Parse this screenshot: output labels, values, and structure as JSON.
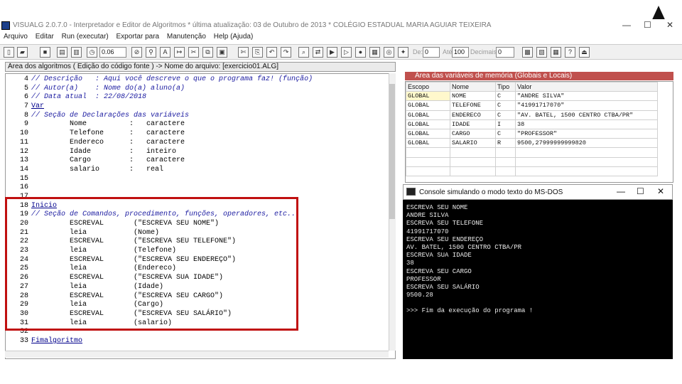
{
  "window": {
    "title": "VISUALG 2.0.7.0 - Interpretador e Editor de Algoritmos * última atualização: 03 de Outubro de 2013 * COLÉGIO ESTADUAL MARIA AGUIAR TEIXEIRA",
    "minimize": "—",
    "maximize": "☐",
    "close": "✕"
  },
  "menu": [
    "Arquivo",
    "Editar",
    "Run (executar)",
    "Exportar para",
    "Manutenção",
    "Help (Ajuda)"
  ],
  "toolbar": {
    "font_size": "0.06",
    "de_label": "De:",
    "de_value": "0",
    "ate_label": "Até:",
    "ate_value": "100",
    "decimais_label": "Decimais:",
    "decimais_value": "0"
  },
  "editor": {
    "header": "Área dos algoritmos ( Edição do código fonte ) -> Nome do arquivo: [exercicio01.ALG]",
    "lines": [
      {
        "n": "4",
        "t": "// Descrição   : Aqui você descreve o que o programa faz! (função)",
        "k": "comment"
      },
      {
        "n": "5",
        "t": "// Autor(a)    : Nome do(a) aluno(a)",
        "k": "comment"
      },
      {
        "n": "6",
        "t": "// Data atual  : 22/08/2018",
        "k": "comment"
      },
      {
        "n": "7",
        "t": "Var",
        "k": "kw"
      },
      {
        "n": "8",
        "t": "// Seção de Declarações das variáveis",
        "k": "comment"
      },
      {
        "n": "9",
        "t": "         Nome          :   caractere",
        "k": "decl"
      },
      {
        "n": "10",
        "t": "         Telefone      :   caractere",
        "k": "decl"
      },
      {
        "n": "11",
        "t": "         Endereco      :   caractere",
        "k": "decl"
      },
      {
        "n": "12",
        "t": "         Idade         :   inteiro",
        "k": "decl"
      },
      {
        "n": "13",
        "t": "         Cargo         :   caractere",
        "k": "decl"
      },
      {
        "n": "14",
        "t": "         salario       :   real",
        "k": "decl"
      },
      {
        "n": "15",
        "t": "",
        "k": "plain"
      },
      {
        "n": "16",
        "t": "",
        "k": "plain"
      },
      {
        "n": "17",
        "t": "",
        "k": "plain"
      },
      {
        "n": "18",
        "t": "Inicio",
        "k": "kw"
      },
      {
        "n": "19",
        "t": "// Seção de Comandos, procedimento, funções, operadores, etc...",
        "k": "comment"
      },
      {
        "n": "20",
        "t": "         ESCREVAL       (\"ESCREVA SEU NOME\")",
        "k": "cmd"
      },
      {
        "n": "21",
        "t": "         leia           (Nome)",
        "k": "plain"
      },
      {
        "n": "22",
        "t": "         ESCREVAL       (\"ESCREVA SEU TELEFONE\")",
        "k": "cmd"
      },
      {
        "n": "23",
        "t": "         leia           (Telefone)",
        "k": "plain"
      },
      {
        "n": "24",
        "t": "         ESCREVAL       (\"ESCREVA SEU ENDEREÇO\")",
        "k": "cmd"
      },
      {
        "n": "25",
        "t": "         leia           (Endereco)",
        "k": "plain"
      },
      {
        "n": "26",
        "t": "         ESCREVAL       (\"ESCREVA SUA IDADE\")",
        "k": "cmd"
      },
      {
        "n": "27",
        "t": "         leia           (Idade)",
        "k": "plain"
      },
      {
        "n": "28",
        "t": "         ESCREVAL       (\"ESCREVA SEU CARGO\")",
        "k": "cmd"
      },
      {
        "n": "29",
        "t": "         leia           (Cargo)",
        "k": "plain"
      },
      {
        "n": "30",
        "t": "         ESCREVAL       (\"ESCREVA SEU SALÁRIO\")",
        "k": "cmd"
      },
      {
        "n": "31",
        "t": "         leia           (salario)",
        "k": "plain"
      },
      {
        "n": "32",
        "t": "",
        "k": "plain"
      },
      {
        "n": "33",
        "t": "Fimalgoritmo",
        "k": "kw"
      }
    ]
  },
  "variables": {
    "title": "Área das variáveis de memória (Globais e Locais)",
    "columns": [
      "Escopo",
      "Nome",
      "Tipo",
      "Valor"
    ],
    "rows": [
      [
        "GLOBAL",
        "NOME",
        "C",
        "\"ANDRE SILVA\""
      ],
      [
        "GLOBAL",
        "TELEFONE",
        "C",
        "\"41991717070\""
      ],
      [
        "GLOBAL",
        "ENDERECO",
        "C",
        "\"AV. BATEL, 1500 CENTRO CTBA/PR\""
      ],
      [
        "GLOBAL",
        "IDADE",
        "I",
        "38"
      ],
      [
        "GLOBAL",
        "CARGO",
        "C",
        "\"PROFESSOR\""
      ],
      [
        "GLOBAL",
        "SALARIO",
        "R",
        "9500,27999999999820"
      ]
    ]
  },
  "console": {
    "title": "Console simulando o modo texto do MS-DOS",
    "lines": [
      "ESCREVA SEU NOME",
      "ANDRE SILVA",
      "ESCREVA SEU TELEFONE",
      "41991717070",
      "ESCREVA SEU ENDEREÇO",
      "AV. BATEL, 1500 CENTRO CTBA/PR",
      "ESCREVA SUA IDADE",
      "38",
      "ESCREVA SEU CARGO",
      "PROFESSOR",
      "ESCREVA SEU SALÁRIO",
      "9500.28",
      "",
      ">>> Fim da execução do programa !"
    ]
  }
}
